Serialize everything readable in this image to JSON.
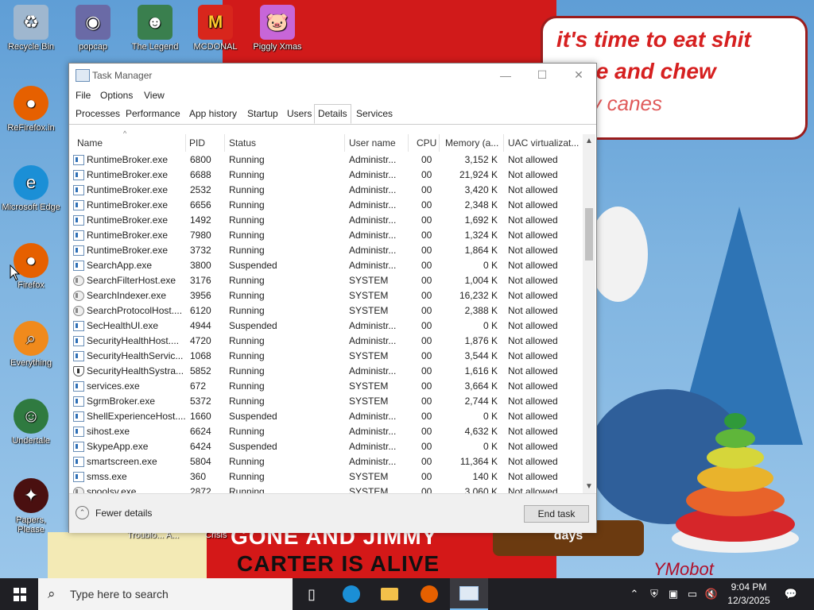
{
  "wallpaper": {
    "bubble_lines": [
      "it's time to eat shit",
      "d die and chew",
      "andy canes"
    ],
    "bottom_text_lines": [
      "GONE AND JIMMY",
      "CARTER IS ALIVE"
    ],
    "days_sign": "days",
    "signature": "YMobot",
    "labels": [
      "Troublo... A...",
      "Crisis"
    ]
  },
  "desktop_icons": [
    {
      "label": "Recycle Bin",
      "icon": "recycle-bin-icon",
      "color": "#9fb7cf"
    },
    {
      "label": "popcap",
      "icon": "popcap-icon",
      "color": "#6a6aa6"
    },
    {
      "label": "The Legend",
      "icon": "game-icon",
      "color": "#3a7f4e"
    },
    {
      "label": "MCDONAL",
      "icon": "mcdonalds-icon",
      "color": "#d8261c"
    },
    {
      "label": "Piggly Xmas",
      "icon": "piggly-icon",
      "color": "#c766d8"
    },
    {
      "label": "ReFirefox.in",
      "icon": "firefox-icon",
      "color": "#e66000"
    },
    {
      "label": "Microsoft Edge",
      "icon": "edge-icon",
      "color": "#1b8fd6"
    },
    {
      "label": "Firefox",
      "icon": "firefox-icon",
      "color": "#e66000"
    },
    {
      "label": "Everything",
      "icon": "everything-icon",
      "color": "#f08a1c"
    },
    {
      "label": "Undertale",
      "icon": "undertale-icon",
      "color": "#2f7a40"
    },
    {
      "label": "Papers, Please",
      "icon": "papers-please-icon",
      "color": "#4a1010"
    }
  ],
  "window": {
    "title": "Task Manager",
    "controls": {
      "minimize": "—",
      "maximize": "☐",
      "close": "✕"
    }
  },
  "menu": [
    "File",
    "Options",
    "View"
  ],
  "tabs": [
    "Processes",
    "Performance",
    "App history",
    "Startup",
    "Users",
    "Details",
    "Services"
  ],
  "active_tab": "Details",
  "columns": [
    "Name",
    "PID",
    "Status",
    "User name",
    "CPU",
    "Memory (a...",
    "UAC virtualizat..."
  ],
  "rows": [
    {
      "name": "RuntimeBroker.exe",
      "pid": "6800",
      "status": "Running",
      "user": "Administr...",
      "cpu": "00",
      "mem": "3,152 K",
      "uac": "Not allowed",
      "icon": "app"
    },
    {
      "name": "RuntimeBroker.exe",
      "pid": "6688",
      "status": "Running",
      "user": "Administr...",
      "cpu": "00",
      "mem": "21,924 K",
      "uac": "Not allowed",
      "icon": "app"
    },
    {
      "name": "RuntimeBroker.exe",
      "pid": "2532",
      "status": "Running",
      "user": "Administr...",
      "cpu": "00",
      "mem": "3,420 K",
      "uac": "Not allowed",
      "icon": "app"
    },
    {
      "name": "RuntimeBroker.exe",
      "pid": "6656",
      "status": "Running",
      "user": "Administr...",
      "cpu": "00",
      "mem": "2,348 K",
      "uac": "Not allowed",
      "icon": "app"
    },
    {
      "name": "RuntimeBroker.exe",
      "pid": "1492",
      "status": "Running",
      "user": "Administr...",
      "cpu": "00",
      "mem": "1,692 K",
      "uac": "Not allowed",
      "icon": "app"
    },
    {
      "name": "RuntimeBroker.exe",
      "pid": "7980",
      "status": "Running",
      "user": "Administr...",
      "cpu": "00",
      "mem": "1,324 K",
      "uac": "Not allowed",
      "icon": "app"
    },
    {
      "name": "RuntimeBroker.exe",
      "pid": "3732",
      "status": "Running",
      "user": "Administr...",
      "cpu": "00",
      "mem": "1,864 K",
      "uac": "Not allowed",
      "icon": "app"
    },
    {
      "name": "SearchApp.exe",
      "pid": "3800",
      "status": "Suspended",
      "user": "Administr...",
      "cpu": "00",
      "mem": "0 K",
      "uac": "Not allowed",
      "icon": "app"
    },
    {
      "name": "SearchFilterHost.exe",
      "pid": "3176",
      "status": "Running",
      "user": "SYSTEM",
      "cpu": "00",
      "mem": "1,004 K",
      "uac": "Not allowed",
      "icon": "sys"
    },
    {
      "name": "SearchIndexer.exe",
      "pid": "3956",
      "status": "Running",
      "user": "SYSTEM",
      "cpu": "00",
      "mem": "16,232 K",
      "uac": "Not allowed",
      "icon": "sys"
    },
    {
      "name": "SearchProtocolHost....",
      "pid": "6120",
      "status": "Running",
      "user": "SYSTEM",
      "cpu": "00",
      "mem": "2,388 K",
      "uac": "Not allowed",
      "icon": "sys"
    },
    {
      "name": "SecHealthUI.exe",
      "pid": "4944",
      "status": "Suspended",
      "user": "Administr...",
      "cpu": "00",
      "mem": "0 K",
      "uac": "Not allowed",
      "icon": "app"
    },
    {
      "name": "SecurityHealthHost....",
      "pid": "4720",
      "status": "Running",
      "user": "Administr...",
      "cpu": "00",
      "mem": "1,876 K",
      "uac": "Not allowed",
      "icon": "app"
    },
    {
      "name": "SecurityHealthServic...",
      "pid": "1068",
      "status": "Running",
      "user": "SYSTEM",
      "cpu": "00",
      "mem": "3,544 K",
      "uac": "Not allowed",
      "icon": "app"
    },
    {
      "name": "SecurityHealthSystra...",
      "pid": "5852",
      "status": "Running",
      "user": "Administr...",
      "cpu": "00",
      "mem": "1,616 K",
      "uac": "Not allowed",
      "icon": "shield"
    },
    {
      "name": "services.exe",
      "pid": "672",
      "status": "Running",
      "user": "SYSTEM",
      "cpu": "00",
      "mem": "3,664 K",
      "uac": "Not allowed",
      "icon": "app"
    },
    {
      "name": "SgrmBroker.exe",
      "pid": "5372",
      "status": "Running",
      "user": "SYSTEM",
      "cpu": "00",
      "mem": "2,744 K",
      "uac": "Not allowed",
      "icon": "app"
    },
    {
      "name": "ShellExperienceHost....",
      "pid": "1660",
      "status": "Suspended",
      "user": "Administr...",
      "cpu": "00",
      "mem": "0 K",
      "uac": "Not allowed",
      "icon": "app"
    },
    {
      "name": "sihost.exe",
      "pid": "6624",
      "status": "Running",
      "user": "Administr...",
      "cpu": "00",
      "mem": "4,632 K",
      "uac": "Not allowed",
      "icon": "app"
    },
    {
      "name": "SkypeApp.exe",
      "pid": "6424",
      "status": "Suspended",
      "user": "Administr...",
      "cpu": "00",
      "mem": "0 K",
      "uac": "Not allowed",
      "icon": "app"
    },
    {
      "name": "smartscreen.exe",
      "pid": "5804",
      "status": "Running",
      "user": "Administr...",
      "cpu": "00",
      "mem": "11,364 K",
      "uac": "Not allowed",
      "icon": "app"
    },
    {
      "name": "smss.exe",
      "pid": "360",
      "status": "Running",
      "user": "SYSTEM",
      "cpu": "00",
      "mem": "140 K",
      "uac": "Not allowed",
      "icon": "app"
    },
    {
      "name": "spoolsv.exe",
      "pid": "2872",
      "status": "Running",
      "user": "SYSTEM",
      "cpu": "00",
      "mem": "3,060 K",
      "uac": "Not allowed",
      "icon": "sys"
    }
  ],
  "footer": {
    "fewer_details": "Fewer details",
    "end_task": "End task"
  },
  "taskbar": {
    "search_placeholder": "Type here to search",
    "pinned": [
      "task-view-icon",
      "edge-icon",
      "file-explorer-icon",
      "firefox-icon",
      "task-manager-icon"
    ],
    "tray_icons": [
      "chevron-up-icon",
      "defender-shield-icon",
      "meet-now-icon",
      "network-icon",
      "volume-muted-icon"
    ],
    "time": "9:04 PM",
    "date": "12/3/2025"
  }
}
